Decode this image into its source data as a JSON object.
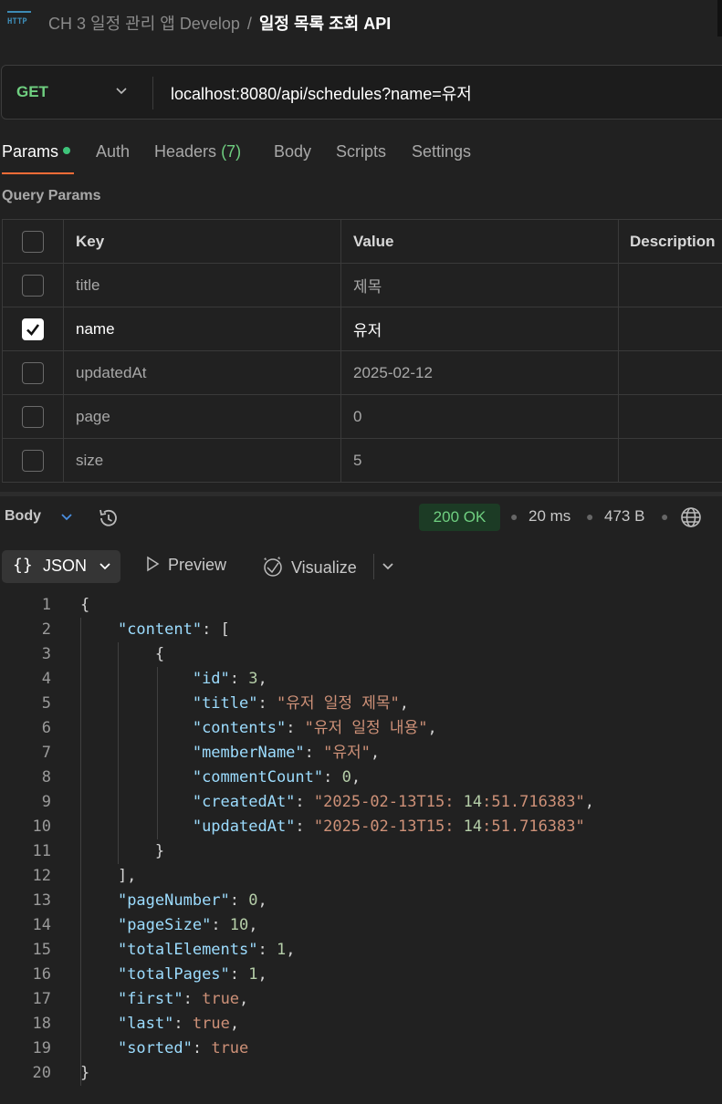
{
  "header": {
    "collection": "CH 3 일정 관리 앱 Develop",
    "separator": "/",
    "request_name": "일정 목록 조회 API",
    "icon": "http-icon"
  },
  "request": {
    "method": "GET",
    "url": "localhost:8080/api/schedules?name=유저"
  },
  "tabs": [
    {
      "label": "Params",
      "active": true
    },
    {
      "label": "Auth"
    },
    {
      "label": "Headers",
      "count": "(7)"
    },
    {
      "label": "Body"
    },
    {
      "label": "Scripts"
    },
    {
      "label": "Settings"
    }
  ],
  "query_params": {
    "title": "Query Params",
    "columns": [
      "Key",
      "Value",
      "Description"
    ],
    "rows": [
      {
        "key": "title",
        "value": "제목",
        "checked": false
      },
      {
        "key": "name",
        "value": "유저",
        "checked": true
      },
      {
        "key": "updatedAt",
        "value": "2025-02-12",
        "checked": false
      },
      {
        "key": "page",
        "value": "0",
        "checked": false
      },
      {
        "key": "size",
        "value": "5",
        "checked": false
      }
    ]
  },
  "response": {
    "section_label": "Body",
    "status": "200 OK",
    "time": "20 ms",
    "size": "473 B",
    "status_color": "#6fcf80"
  },
  "format": {
    "json_label": "JSON",
    "preview_label": "Preview",
    "visualize_label": "Visualize"
  },
  "code_lines": [
    "{",
    "    \"content\": [",
    "        {",
    "            \"id\": 3,",
    "            \"title\": \"유저 일정 제목\",",
    "            \"contents\": \"유저 일정 내용\",",
    "            \"memberName\": \"유저\",",
    "            \"commentCount\": 0,",
    "            \"createdAt\": \"2025-02-13T15:14:51.716383\",",
    "            \"updatedAt\": \"2025-02-13T15:14:51.716383\"",
    "        }",
    "    ],",
    "    \"pageNumber\": 0,",
    "    \"pageSize\": 10,",
    "    \"totalElements\": 1,",
    "    \"totalPages\": 1,",
    "    \"first\": true,",
    "    \"last\": true,",
    "    \"sorted\": true",
    "}"
  ]
}
